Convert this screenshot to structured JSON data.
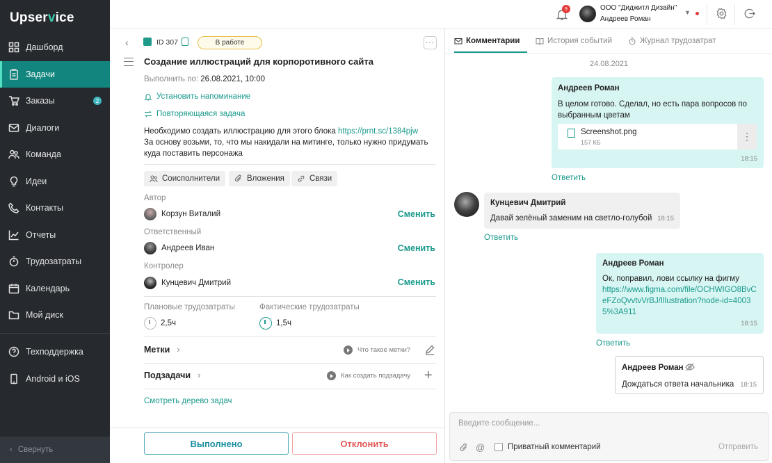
{
  "sidebar": {
    "logo_a": "Upser",
    "logo_v": "v",
    "logo_b": "ice",
    "items": [
      {
        "label": "Дашборд",
        "icon": "dashboard-icon"
      },
      {
        "label": "Задачи",
        "icon": "tasks-icon",
        "active": true
      },
      {
        "label": "Заказы",
        "icon": "cart-icon",
        "badge": "2"
      },
      {
        "label": "Диалоги",
        "icon": "mail-icon"
      },
      {
        "label": "Команда",
        "icon": "team-icon"
      },
      {
        "label": "Идеи",
        "icon": "bulb-icon"
      },
      {
        "label": "Контакты",
        "icon": "phone-icon"
      },
      {
        "label": "Отчеты",
        "icon": "chart-icon"
      },
      {
        "label": "Трудозатраты",
        "icon": "stopwatch-icon"
      },
      {
        "label": "Календарь",
        "icon": "calendar-icon"
      },
      {
        "label": "Мой диск",
        "icon": "folder-icon"
      }
    ],
    "bottom_items": [
      {
        "label": "Техподдержка",
        "icon": "help-icon"
      },
      {
        "label": "Android и iOS",
        "icon": "mobile-icon"
      }
    ],
    "collapse_label": "Свернуть"
  },
  "header": {
    "notifications_count": "9",
    "company": "ООО \"Диджитл Дизайн\"",
    "user": "Андреев Роман"
  },
  "task": {
    "id": "ID 307",
    "status": "В работе",
    "more": "···",
    "title": "Создание иллюстраций для корпоротивного сайта",
    "due_label": "Выполнить по:",
    "due_value": "26.08.2021, 10:00",
    "reminder": "Установить напоминание",
    "repeat": "Повторяющаяся задача",
    "desc_line1": "Необходимо создать иллюстрацию для этого блока ",
    "desc_link": "https://prnt.sc/1384pjw",
    "desc_line2": "За основу возьми, то, что мы накидали на митинге, только нужно придумать куда поставить персонажа",
    "chips": [
      "Соисполнители",
      "Вложения",
      "Связи"
    ],
    "author_label": "Автор",
    "author": "Корзун Виталий",
    "responsible_label": "Ответственный",
    "responsible": "Андреев Иван",
    "controller_label": "Контролер",
    "controller": "Кунцевич Дмитрий",
    "change": "Сменить",
    "plan_label": "Плановые трудозатраты",
    "plan_value": "2,5ч",
    "fact_label": "Фактические трудозатраты",
    "fact_value": "1,5ч",
    "tags_label": "Метки",
    "tags_help": "Что такое метки?",
    "subtasks_label": "Подзадачи",
    "subtasks_help": "Как создать подзадачу",
    "tree_link": "Смотреть дерево задач",
    "done_button": "Выполнено",
    "reject_button": "Отклонить"
  },
  "right": {
    "tabs": [
      "Комментарии",
      "История событий",
      "Журнал трудозатрат"
    ],
    "date": "24.08.2021",
    "reply": "Ответить",
    "messages": [
      {
        "author": "Андреев Роман",
        "text": "В целом готово. Сделал, но есть пара вопросов по выбранным цветам",
        "file_name": "Screenshot.png",
        "file_size": "157 КБ",
        "time": "18:15"
      },
      {
        "author": "Кунцевич Дмитрий",
        "text": "Давай зелёный заменим на светло-голубой",
        "time": "18:15"
      },
      {
        "author": "Андреев Роман",
        "text": "Ок, поправил, лови ссылку на фигму",
        "link": "https://www.figma.com/file/OCHWIGO8BvCeFZoQvvtvVrBJ/Illustration?node-id=40035%3A911",
        "time": "18:15"
      },
      {
        "author": "Андреев Роман",
        "text": "Дождаться ответа начальника",
        "time": "18:15"
      }
    ],
    "composer_placeholder": "Введите сообщение...",
    "at_symbol": "@",
    "private_label": "Приватный комментарий",
    "send": "Отправить"
  }
}
